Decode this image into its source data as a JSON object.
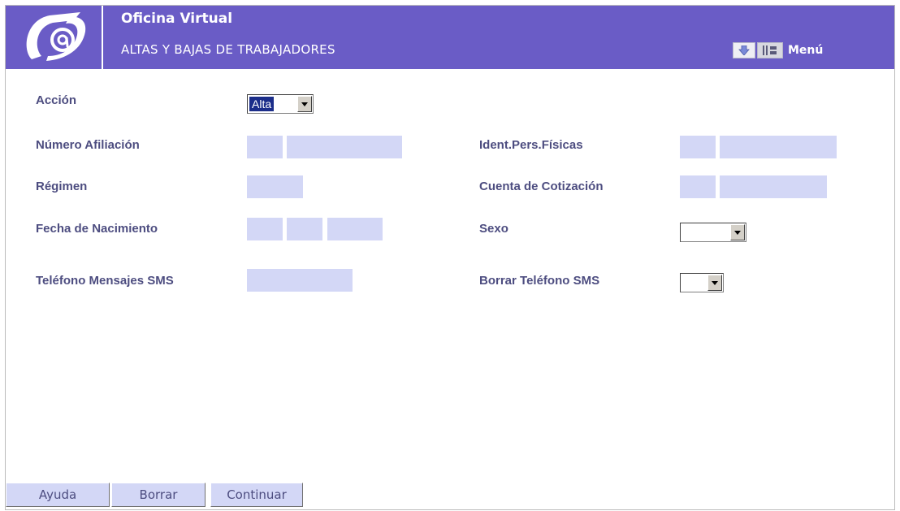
{
  "header": {
    "title": "Oficina Virtual",
    "subtitle": "ALTAS Y BAJAS DE TRABAJADORES",
    "menu_label": "Menú",
    "logo_icon": "at-sign-logo-icon",
    "menu_icons": [
      "down-arrow-icon",
      "tools-icon"
    ],
    "background_color": "#6a5cc6"
  },
  "form": {
    "accion": {
      "label": "Acción",
      "selected": "Alta"
    },
    "numero_afiliacion": {
      "label": "Número Afiliación"
    },
    "ident_pers_fisicas": {
      "label": "Ident.Pers.Físicas"
    },
    "regimen": {
      "label": "Régimen"
    },
    "cuenta_cotizacion": {
      "label": "Cuenta de Cotización"
    },
    "fecha_nacimiento": {
      "label": "Fecha de Nacimiento"
    },
    "sexo": {
      "label": "Sexo",
      "selected": ""
    },
    "telefono_sms": {
      "label": "Teléfono Mensajes SMS"
    },
    "borrar_telefono_sms": {
      "label": "Borrar Teléfono SMS",
      "selected": ""
    },
    "field_color": "#d3d7f6",
    "label_color": "#4d4d80"
  },
  "buttons": {
    "ayuda": "Ayuda",
    "borrar": "Borrar",
    "continuar": "Continuar"
  }
}
